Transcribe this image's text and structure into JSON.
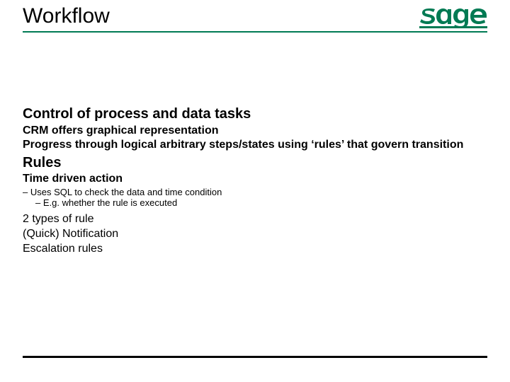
{
  "title": "Workflow",
  "logo": {
    "name": "sage",
    "color": "#007a53"
  },
  "section1": {
    "heading": "Control of process and data tasks",
    "line1": "CRM offers graphical representation",
    "line2": "Progress through logical arbitrary steps/states using ‘rules’ that govern transition"
  },
  "section2": {
    "heading": "Rules",
    "sub_heading": "Time driven action",
    "bullet1": "–  Uses SQL to check the data and time condition",
    "bullet2": "–  E.g. whether the rule is executed",
    "line1": "2 types of rule",
    "line2": "(Quick) Notification",
    "line3": "Escalation rules"
  }
}
